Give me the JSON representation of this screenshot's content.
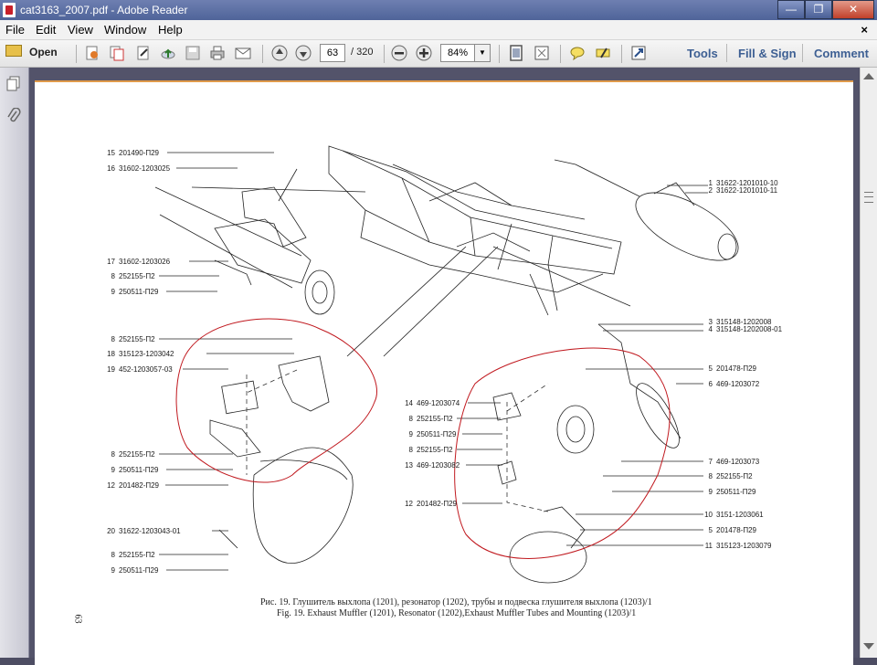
{
  "window": {
    "title": "cat3163_2007.pdf - Adobe Reader",
    "min": "—",
    "max": "❐",
    "close": "✕"
  },
  "menu": {
    "items": [
      "File",
      "Edit",
      "View",
      "Window",
      "Help"
    ],
    "close_doc": "×"
  },
  "toolbar": {
    "open_label": "Open",
    "page_current": "63",
    "page_total": "/ 320",
    "zoom": "84%",
    "tools": "Tools",
    "fill_sign": "Fill & Sign",
    "comment": "Comment"
  },
  "drawing": {
    "labels": [
      {
        "n": "15",
        "code": "201490-П29"
      },
      {
        "n": "16",
        "code": "31602-1203025"
      },
      {
        "n": "17",
        "code": "31602-1203026"
      },
      {
        "n": "8",
        "code": "252155-П2"
      },
      {
        "n": "9",
        "code": "250511-П29"
      },
      {
        "n": "8",
        "code": "252155-П2"
      },
      {
        "n": "18",
        "code": "315123-1203042"
      },
      {
        "n": "19",
        "code": "452-1203057-03"
      },
      {
        "n": "8",
        "code": "252155-П2"
      },
      {
        "n": "9",
        "code": "250511-П29"
      },
      {
        "n": "12",
        "code": "201482-П29"
      },
      {
        "n": "20",
        "code": "31622-1203043-01"
      },
      {
        "n": "8",
        "code": "252155-П2"
      },
      {
        "n": "9",
        "code": "250511-П29"
      },
      {
        "n": "1",
        "code": "31622-1201010-10"
      },
      {
        "n": "2",
        "code": "31622-1201010-11"
      },
      {
        "n": "3",
        "code": "315148-1202008"
      },
      {
        "n": "4",
        "code": "315148-1202008-01"
      },
      {
        "n": "5",
        "code": "201478-П29"
      },
      {
        "n": "6",
        "code": "469-1203072"
      },
      {
        "n": "14",
        "code": "469-1203074"
      },
      {
        "n": "8",
        "code": "252155-П2"
      },
      {
        "n": "9",
        "code": "250511-П29"
      },
      {
        "n": "8",
        "code": "252155-П2"
      },
      {
        "n": "13",
        "code": "469-1203082"
      },
      {
        "n": "7",
        "code": "469-1203073"
      },
      {
        "n": "8",
        "code": "252155-П2"
      },
      {
        "n": "9",
        "code": "250511-П29"
      },
      {
        "n": "12",
        "code": "201482-П29"
      },
      {
        "n": "10",
        "code": "3151-1203061"
      },
      {
        "n": "5",
        "code": "201478-П29"
      },
      {
        "n": "11",
        "code": "315123-1203079"
      }
    ],
    "caption_ru": "Рис. 19. Глушитель выхлопа (1201), резонатор (1202), трубы и подвеска глушителя выхлопа (1203)/1",
    "caption_en": "Fig. 19. Exhaust Muffler (1201), Resonator (1202),Exhaust Muffler Tubes and Mounting (1203)/1",
    "page_number": "63"
  },
  "colors": {
    "titlebar": "#5a6ea3",
    "link": "#3d5f93",
    "annotation": "#c0181e"
  }
}
